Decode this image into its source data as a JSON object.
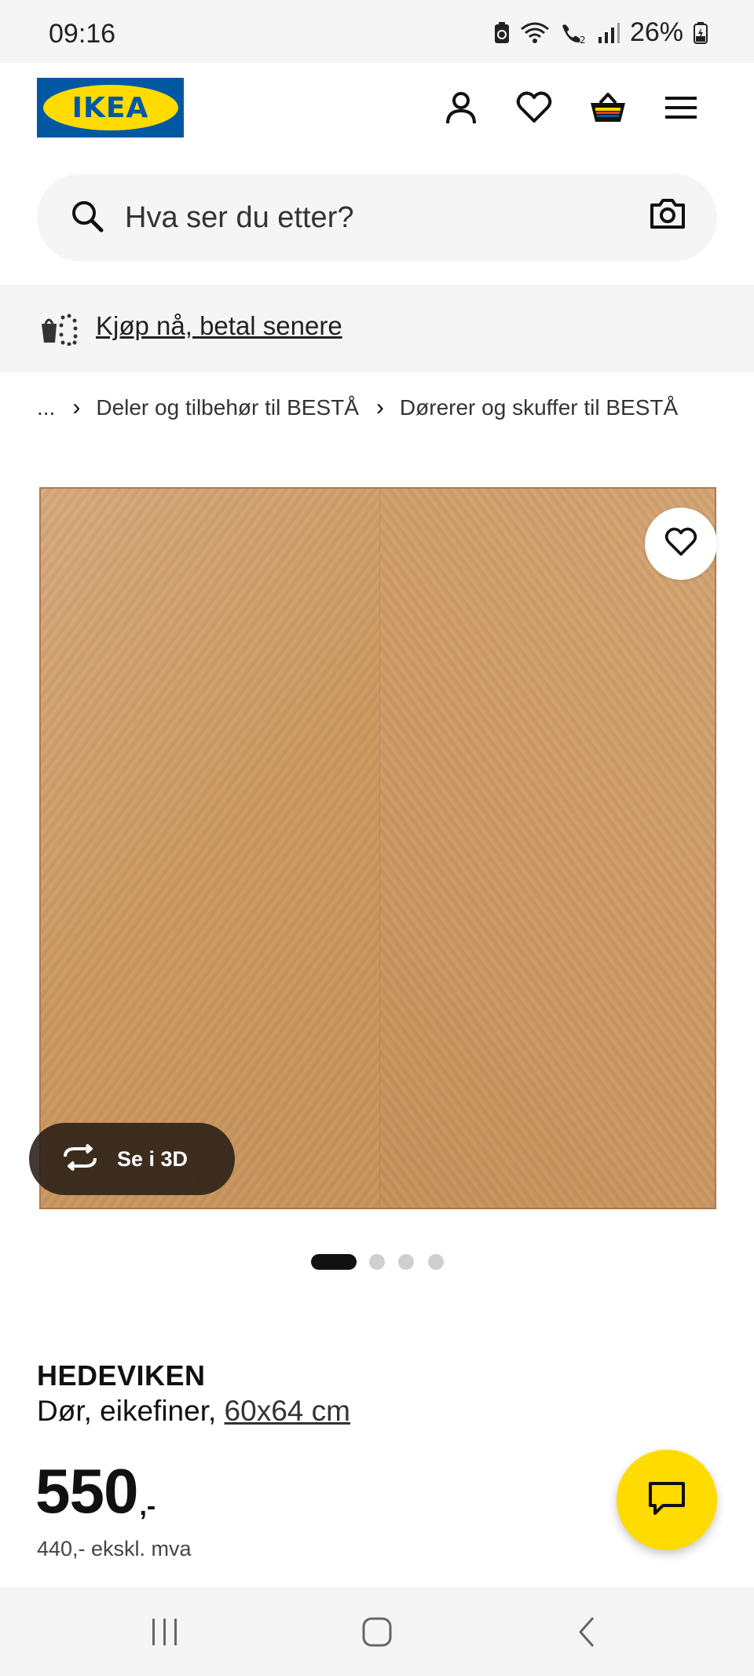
{
  "status_bar": {
    "time": "09:16",
    "battery": "26%",
    "icons": [
      "battery-saver-icon",
      "wifi-icon",
      "wifi-calling-icon",
      "signal-icon",
      "battery-icon"
    ]
  },
  "header": {
    "logo_text": "IKEA",
    "icons": [
      "user-icon",
      "heart-icon",
      "basket-icon",
      "menu-icon"
    ]
  },
  "search": {
    "placeholder": "Hva ser du etter?"
  },
  "promo": {
    "label": "Kjøp nå, betal senere"
  },
  "breadcrumb": {
    "items": [
      "...",
      "Deler og tilbehør til BESTÅ",
      "Dørerer og skuffer til BESTÅ"
    ]
  },
  "gallery": {
    "view_3d_label": "Se i 3D",
    "dot_count": 4,
    "active_dot": 0
  },
  "product": {
    "name": "HEDEVIKEN",
    "description": "Dør, eikefiner,",
    "size": "60x64 cm",
    "price": "550",
    "price_suffix": ",-",
    "price_ex_vat": "440,- ekskl. mva"
  },
  "colors": {
    "ikea_blue": "#0058a3",
    "ikea_yellow": "#ffdb00",
    "light_gray": "#f5f5f5"
  }
}
